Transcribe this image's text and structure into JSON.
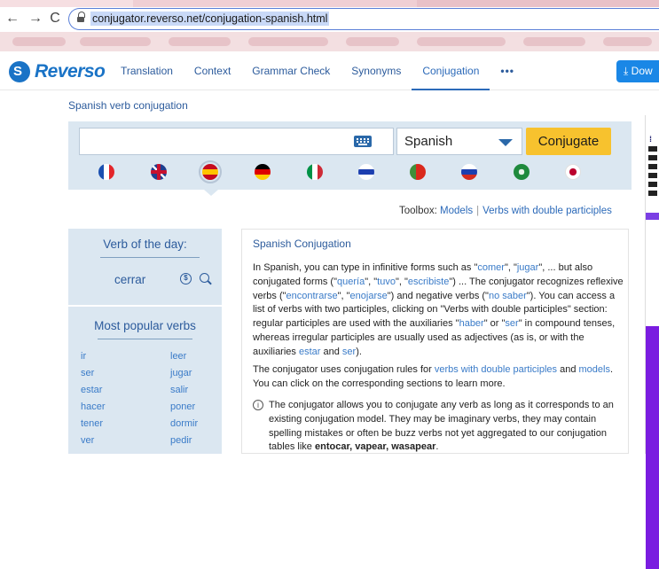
{
  "browser": {
    "url": "conjugator.reverso.net/conjugation-spanish.html",
    "back_glyph": "←",
    "forward_glyph": "→",
    "reload_glyph": "C"
  },
  "header": {
    "logo_text": "Reverso",
    "nav": [
      "Translation",
      "Context",
      "Grammar Check",
      "Synonyms",
      "Conjugation",
      "•••"
    ],
    "active_nav": "Conjugation",
    "download_label": "Dow"
  },
  "breadcrumb": "Spanish verb conjugation",
  "search": {
    "input_value": "",
    "language": "Spanish",
    "conjugate_label": "Conjugate",
    "flags": [
      {
        "name": "french",
        "colors": [
          "#1a4fb0",
          "#ffffff",
          "#e3262b"
        ]
      },
      {
        "name": "english",
        "colors": [
          "#1f3f8f",
          "#ffffff",
          "#c8102e"
        ]
      },
      {
        "name": "spanish",
        "colors": [
          "#c60b1e",
          "#ffc400",
          "#c60b1e"
        ]
      },
      {
        "name": "german",
        "colors": [
          "#000000",
          "#dd0000",
          "#ffce00"
        ]
      },
      {
        "name": "italian",
        "colors": [
          "#009246",
          "#ffffff",
          "#ce2b37"
        ]
      },
      {
        "name": "hebrew",
        "colors": [
          "#ffffff",
          "#1c3fb0",
          "#ffffff"
        ]
      },
      {
        "name": "portuguese",
        "colors": [
          "#046a38",
          "#da291c",
          "#da291c"
        ]
      },
      {
        "name": "russian",
        "colors": [
          "#ffffff",
          "#1c3fb0",
          "#d52b1e"
        ]
      },
      {
        "name": "arabic",
        "colors": [
          "#1f8a3d",
          "#1f8a3d",
          "#1f8a3d"
        ]
      },
      {
        "name": "japanese",
        "colors": [
          "#ffffff",
          "#bc002d",
          "#ffffff"
        ]
      }
    ],
    "selected_flag": "spanish"
  },
  "toolbox": {
    "label": "Toolbox:",
    "models": "Models",
    "separator": "|",
    "double_participles": "Verbs with double participles"
  },
  "verb_of_day": {
    "heading": "Verb of the day:",
    "verb": "cerrar",
    "audio_glyph": "$"
  },
  "popular": {
    "heading": "Most popular verbs",
    "left": [
      "ir",
      "ser",
      "estar",
      "hacer",
      "tener",
      "ver"
    ],
    "right": [
      "leer",
      "jugar",
      "salir",
      "poner",
      "dormir",
      "pedir"
    ]
  },
  "article": {
    "title": "Spanish Conjugation",
    "p1": [
      {
        "t": "In Spanish, you can type in infinitive forms such as \""
      },
      {
        "l": "comer"
      },
      {
        "t": "\", \""
      },
      {
        "l": "jugar"
      },
      {
        "t": "\", ... but also conjugated forms (\""
      },
      {
        "l": "quería"
      },
      {
        "t": "\", \""
      },
      {
        "l": "tuvo"
      },
      {
        "t": "\", \""
      },
      {
        "l": "escribiste"
      },
      {
        "t": "\") ... The conjugator recognizes reflexive verbs (\""
      },
      {
        "l": "encontrarse"
      },
      {
        "t": "\", \""
      },
      {
        "l": "enojarse"
      },
      {
        "t": "\") and negative verbs (\""
      },
      {
        "l": "no saber"
      },
      {
        "t": "\"). You can access a list of verbs with two participles, clicking on \"Verbs with double participles\" section: regular participles are used with the auxiliaries \""
      },
      {
        "l": "haber"
      },
      {
        "t": "\" or \""
      },
      {
        "l": "ser"
      },
      {
        "t": "\" in compound tenses, whereas irregular participles are usually used as adjectives (as is, or with the auxiliaries "
      },
      {
        "l": "estar"
      },
      {
        "t": " and "
      },
      {
        "l": "ser"
      },
      {
        "t": ")."
      }
    ],
    "p2": [
      {
        "t": "The conjugator uses conjugation rules for "
      },
      {
        "l": "verbs with double participles"
      },
      {
        "t": " and "
      },
      {
        "l": "models"
      },
      {
        "t": ". You can click on the corresponding sections to learn more."
      }
    ],
    "p3": [
      {
        "t": "The conjugator allows you to conjugate any verb as long as it corresponds to an existing conjugation model. They may be imaginary verbs, they may contain spelling mistakes or often be buzz verbs not yet aggregated to our conjugation tables like "
      },
      {
        "b": "entocar, vapear, wasapear"
      },
      {
        "t": "."
      }
    ],
    "info_glyph": "i"
  },
  "colors": {
    "brand": "#1a73c6",
    "panel": "#dbe7f1",
    "conjugate_button": "#f7c22e",
    "link": "#3a7bc8"
  }
}
